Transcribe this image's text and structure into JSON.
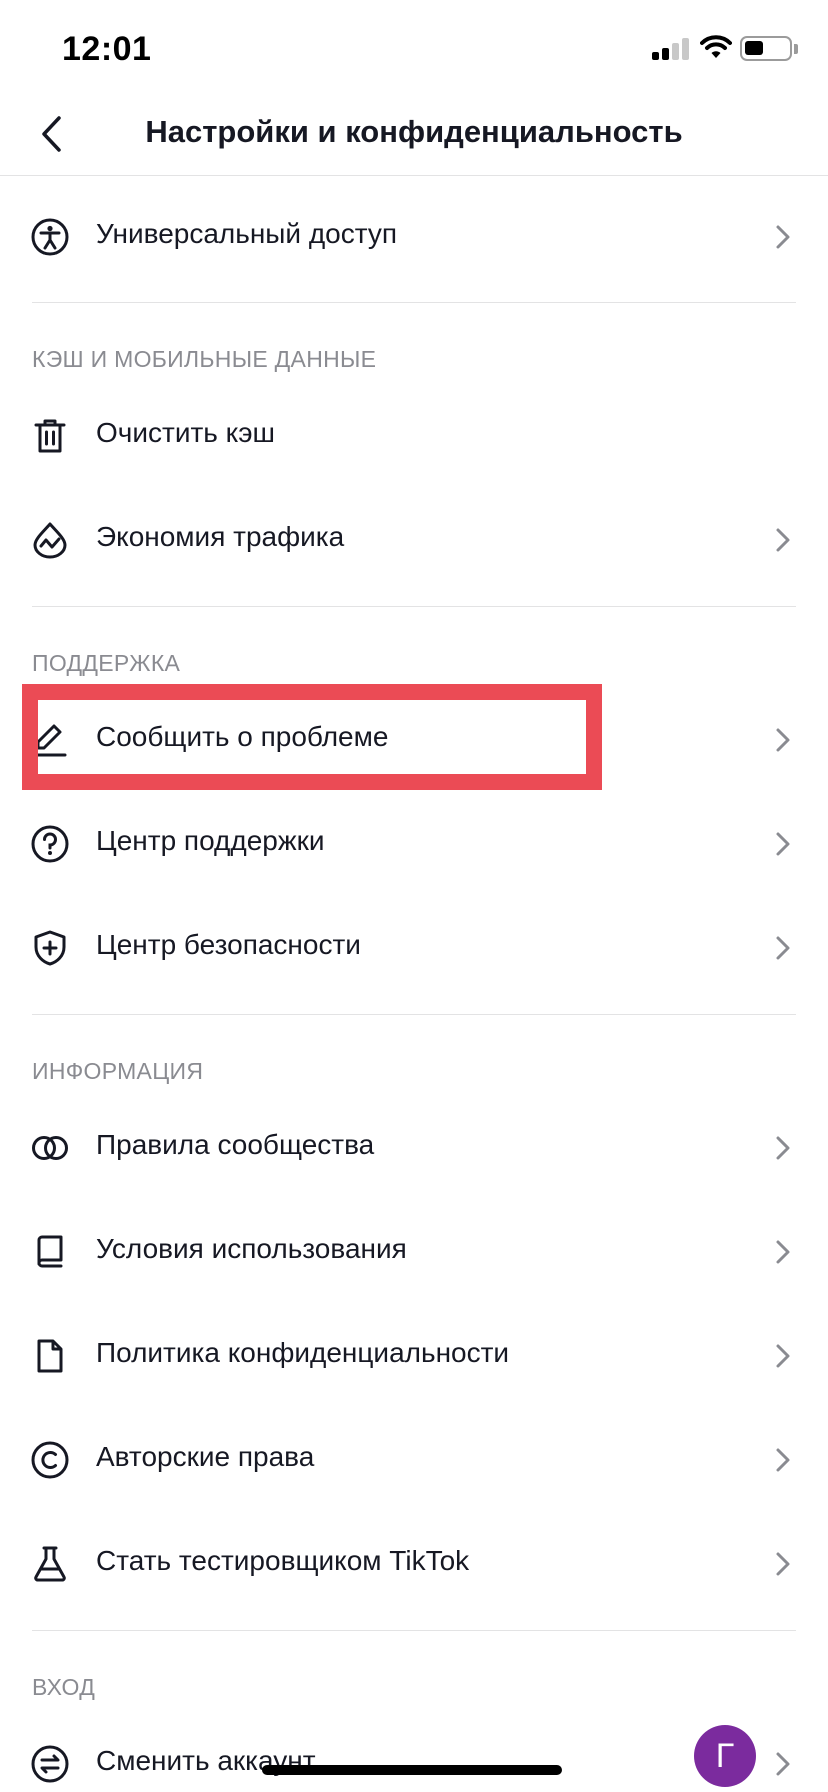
{
  "status_bar": {
    "time": "12:01"
  },
  "header": {
    "title": "Настройки и конфиденциальность"
  },
  "items": {
    "accessibility": "Универсальный доступ",
    "clear_cache": "Очистить кэш",
    "data_saver": "Экономия трафика",
    "report_problem": "Сообщить о проблеме",
    "help_center": "Центр поддержки",
    "safety_center": "Центр безопасности",
    "community_guidelines": "Правила сообщества",
    "terms_of_use": "Условия использования",
    "privacy_policy": "Политика конфиденциальности",
    "copyright": "Авторские права",
    "become_tester": "Стать тестировщиком TikTok",
    "switch_account": "Сменить аккаунт"
  },
  "sections": {
    "cache": "КЭШ И МОБИЛЬНЫЕ ДАННЫЕ",
    "support": "ПОДДЕРЖКА",
    "info": "ИНФОРМАЦИЯ",
    "login": "ВХОД"
  },
  "account": {
    "avatar_letter": "Г",
    "avatar_color": "#7b2b9e"
  },
  "colors": {
    "highlight": "#eb4b55",
    "text": "#161823",
    "section": "#8a8b91",
    "divider": "#e3e3e4"
  },
  "icons": {
    "accessibility": "accessibility-person-icon",
    "clear_cache": "trash-icon",
    "data_saver": "droplet-pulse-icon",
    "report_problem": "pencil-icon",
    "help_center": "question-circle-icon",
    "safety_center": "shield-plus-icon",
    "community_guidelines": "two-circles-icon",
    "terms_of_use": "book-icon",
    "privacy_policy": "document-icon",
    "copyright": "copyright-icon",
    "become_tester": "flask-icon",
    "switch_account": "switch-arrows-icon"
  }
}
